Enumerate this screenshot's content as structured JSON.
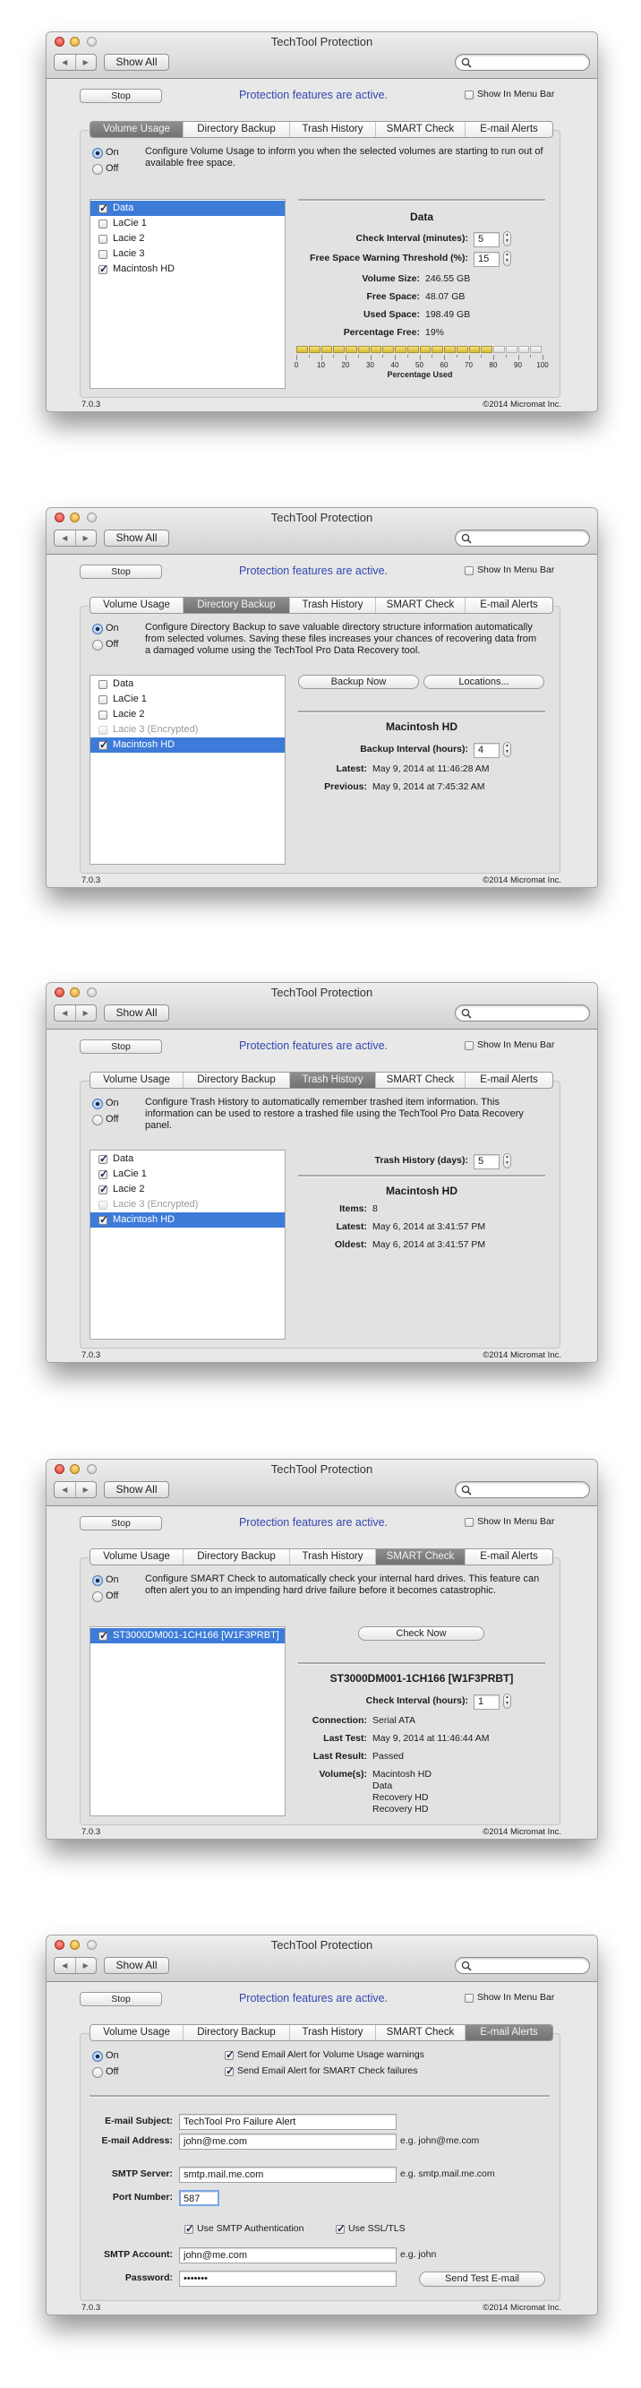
{
  "common": {
    "title": "TechTool Protection",
    "show_all": "Show All",
    "stop": "Stop",
    "status": "Protection features are active.",
    "show_in_menu_bar": "Show In Menu Bar",
    "show_in_menu_bar_checked": false,
    "on": "On",
    "off": "Off",
    "version": "7.0.3",
    "copyright": "©2014 Micromat Inc.",
    "tabs": [
      "Volume Usage",
      "Directory Backup",
      "Trash History",
      "SMART Check",
      "E-mail Alerts"
    ],
    "icons": {
      "back": "chevron-left-icon",
      "forward": "chevron-right-icon",
      "search": "search-icon"
    }
  },
  "colors": {
    "selection": "#3d7bd9",
    "status_text": "#3447b0",
    "bar_fill": "#e2c643",
    "active_tab": "#7f7f7f"
  },
  "screens": [
    {
      "active_tab": 0,
      "enabled": true,
      "description": "Configure Volume Usage to inform you when the selected volumes are starting to run out of available free space."
    },
    {
      "active_tab": 1,
      "enabled": true,
      "description": "Configure Directory Backup to save valuable directory structure information automatically from selected volumes. Saving these files increases your chances of recovering data from a damaged volume using the TechTool Pro Data Recovery tool."
    },
    {
      "active_tab": 2,
      "enabled": true,
      "description": "Configure Trash History to automatically remember trashed item information. This information can be used to restore a trashed file using the TechTool Pro Data Recovery panel."
    },
    {
      "active_tab": 3,
      "enabled": true,
      "description": "Configure SMART Check to automatically check your internal hard drives. This feature can often alert you to an impending hard drive failure before it becomes catastrophic."
    },
    {
      "active_tab": 4,
      "enabled": true
    }
  ],
  "volume_usage": {
    "volumes": [
      {
        "label": "Data",
        "checked": true,
        "selected": true,
        "disabled": false
      },
      {
        "label": "LaCie 1",
        "checked": false,
        "selected": false,
        "disabled": false
      },
      {
        "label": "Lacie 2",
        "checked": false,
        "selected": false,
        "disabled": false
      },
      {
        "label": "Lacie 3",
        "checked": false,
        "selected": false,
        "disabled": false
      },
      {
        "label": "Macintosh HD",
        "checked": true,
        "selected": false,
        "disabled": false
      }
    ],
    "detail_title": "Data",
    "check_interval_label": "Check Interval (minutes):",
    "check_interval": "5",
    "threshold_label": "Free Space Warning Threshold (%):",
    "threshold": "15",
    "rows": [
      {
        "label": "Volume Size:",
        "value": "246.55 GB"
      },
      {
        "label": "Free Space:",
        "value": "48.07 GB"
      },
      {
        "label": "Used Space:",
        "value": "198.49 GB"
      },
      {
        "label": "Percentage Free:",
        "value": "19%"
      }
    ],
    "gauge": {
      "segments_total": 20,
      "segments_filled": 16,
      "tick_labels": [
        "0",
        "10",
        "20",
        "30",
        "40",
        "50",
        "60",
        "70",
        "80",
        "90",
        "100"
      ],
      "axis_label": "Percentage Used"
    }
  },
  "directory_backup": {
    "volumes": [
      {
        "label": "Data",
        "checked": false,
        "selected": false,
        "disabled": false
      },
      {
        "label": "LaCie 1",
        "checked": false,
        "selected": false,
        "disabled": false
      },
      {
        "label": "Lacie 2",
        "checked": false,
        "selected": false,
        "disabled": false
      },
      {
        "label": "Lacie 3 (Encrypted)",
        "checked": false,
        "selected": false,
        "disabled": true
      },
      {
        "label": "Macintosh HD",
        "checked": true,
        "selected": true,
        "disabled": false
      }
    ],
    "backup_now": "Backup Now",
    "locations": "Locations...",
    "detail_title": "Macintosh HD",
    "interval_label": "Backup Interval (hours):",
    "interval": "4",
    "rows": [
      {
        "label": "Latest:",
        "value": "May 9, 2014 at 11:46:28 AM"
      },
      {
        "label": "Previous:",
        "value": "May 9, 2014 at 7:45:32 AM"
      }
    ]
  },
  "trash_history": {
    "volumes": [
      {
        "label": "Data",
        "checked": true,
        "selected": false,
        "disabled": false
      },
      {
        "label": "LaCie 1",
        "checked": true,
        "selected": false,
        "disabled": false
      },
      {
        "label": "Lacie 2",
        "checked": true,
        "selected": false,
        "disabled": false
      },
      {
        "label": "Lacie 3 (Encrypted)",
        "checked": false,
        "selected": false,
        "disabled": true
      },
      {
        "label": "Macintosh HD",
        "checked": true,
        "selected": true,
        "disabled": false
      }
    ],
    "days_label": "Trash History (days):",
    "days": "5",
    "detail_title": "Macintosh HD",
    "rows": [
      {
        "label": "Items:",
        "value": "8"
      },
      {
        "label": "Latest:",
        "value": "May 6, 2014 at 3:41:57 PM"
      },
      {
        "label": "Oldest:",
        "value": "May 6, 2014 at 3:41:57 PM"
      }
    ]
  },
  "smart_check": {
    "drives": [
      {
        "label": "ST3000DM001-1CH166 [W1F3PRBT]",
        "checked": true,
        "selected": true,
        "disabled": false
      }
    ],
    "check_now": "Check Now",
    "detail_title": "ST3000DM001-1CH166 [W1F3PRBT]",
    "interval_label": "Check Interval (hours):",
    "interval": "1",
    "rows": [
      {
        "label": "Connection:",
        "value": "Serial ATA"
      },
      {
        "label": "Last Test:",
        "value": "May 9, 2014 at 11:46:44 AM"
      },
      {
        "label": "Last Result:",
        "value": "Passed"
      }
    ],
    "volumes_label": "Volume(s):",
    "volumes": [
      "Macintosh HD",
      "Data",
      "Recovery HD",
      "Recovery HD"
    ]
  },
  "email_alerts": {
    "alert_volume_usage": {
      "label": "Send Email Alert for Volume Usage warnings",
      "checked": true
    },
    "alert_smart": {
      "label": "Send Email Alert for SMART Check failures",
      "checked": true
    },
    "subject_label": "E-mail Subject:",
    "subject": "TechTool Pro Failure Alert",
    "address_label": "E-mail Address:",
    "address": "john@me.com",
    "address_hint": "e.g. john@me.com",
    "server_label": "SMTP Server:",
    "server": "smtp.mail.me.com",
    "server_hint": "e.g. smtp.mail.me.com",
    "port_label": "Port Number:",
    "port": "587",
    "use_auth": {
      "label": "Use SMTP Authentication",
      "checked": true
    },
    "use_ssl": {
      "label": "Use SSL/TLS",
      "checked": true
    },
    "account_label": "SMTP Account:",
    "account": "john@me.com",
    "account_hint": "e.g. john",
    "password_label": "Password:",
    "password": "•••••••",
    "send_test": "Send Test E-mail"
  }
}
